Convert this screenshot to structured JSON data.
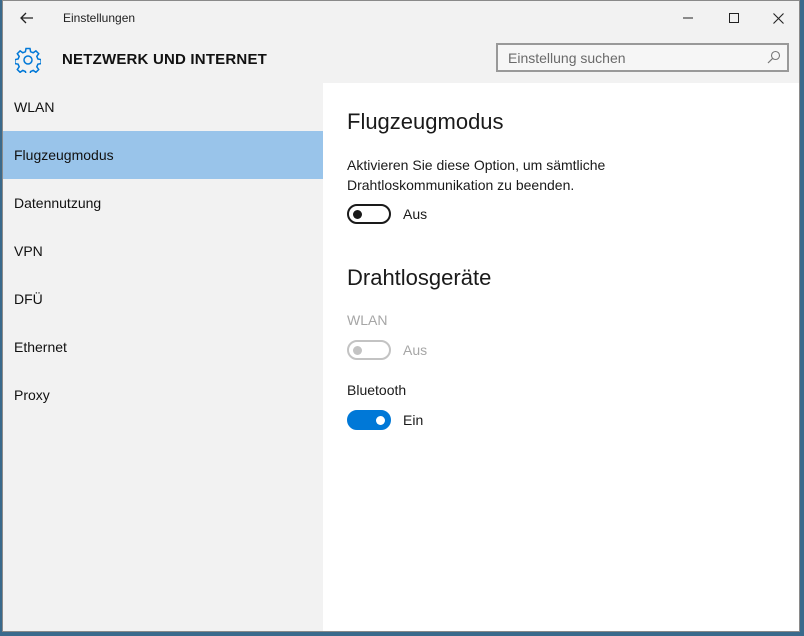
{
  "window": {
    "title": "Einstellungen"
  },
  "header": {
    "section_title": "NETZWERK UND INTERNET",
    "search_placeholder": "Einstellung suchen"
  },
  "sidebar": {
    "items": [
      {
        "label": "WLAN",
        "selected": false
      },
      {
        "label": "Flugzeugmodus",
        "selected": true
      },
      {
        "label": "Datennutzung",
        "selected": false
      },
      {
        "label": "VPN",
        "selected": false
      },
      {
        "label": "DFÜ",
        "selected": false
      },
      {
        "label": "Ethernet",
        "selected": false
      },
      {
        "label": "Proxy",
        "selected": false
      }
    ]
  },
  "content": {
    "airplane": {
      "heading": "Flugzeugmodus",
      "description": "Aktivieren Sie diese Option, um sämtliche Drahtloskommunikation zu beenden.",
      "toggle_state": "Aus"
    },
    "wireless": {
      "heading": "Drahtlosgeräte",
      "wlan_label": "WLAN",
      "wlan_state": "Aus",
      "bluetooth_label": "Bluetooth",
      "bluetooth_state": "Ein"
    }
  },
  "colors": {
    "accent": "#0078d7",
    "selected_nav": "#99c4ea",
    "gear_icon": "#0078d7"
  },
  "icons": {
    "back": "back-arrow-icon",
    "minimize": "minimize-icon",
    "maximize": "maximize-icon",
    "close": "close-icon",
    "settings": "gear-icon",
    "search": "search-icon"
  }
}
